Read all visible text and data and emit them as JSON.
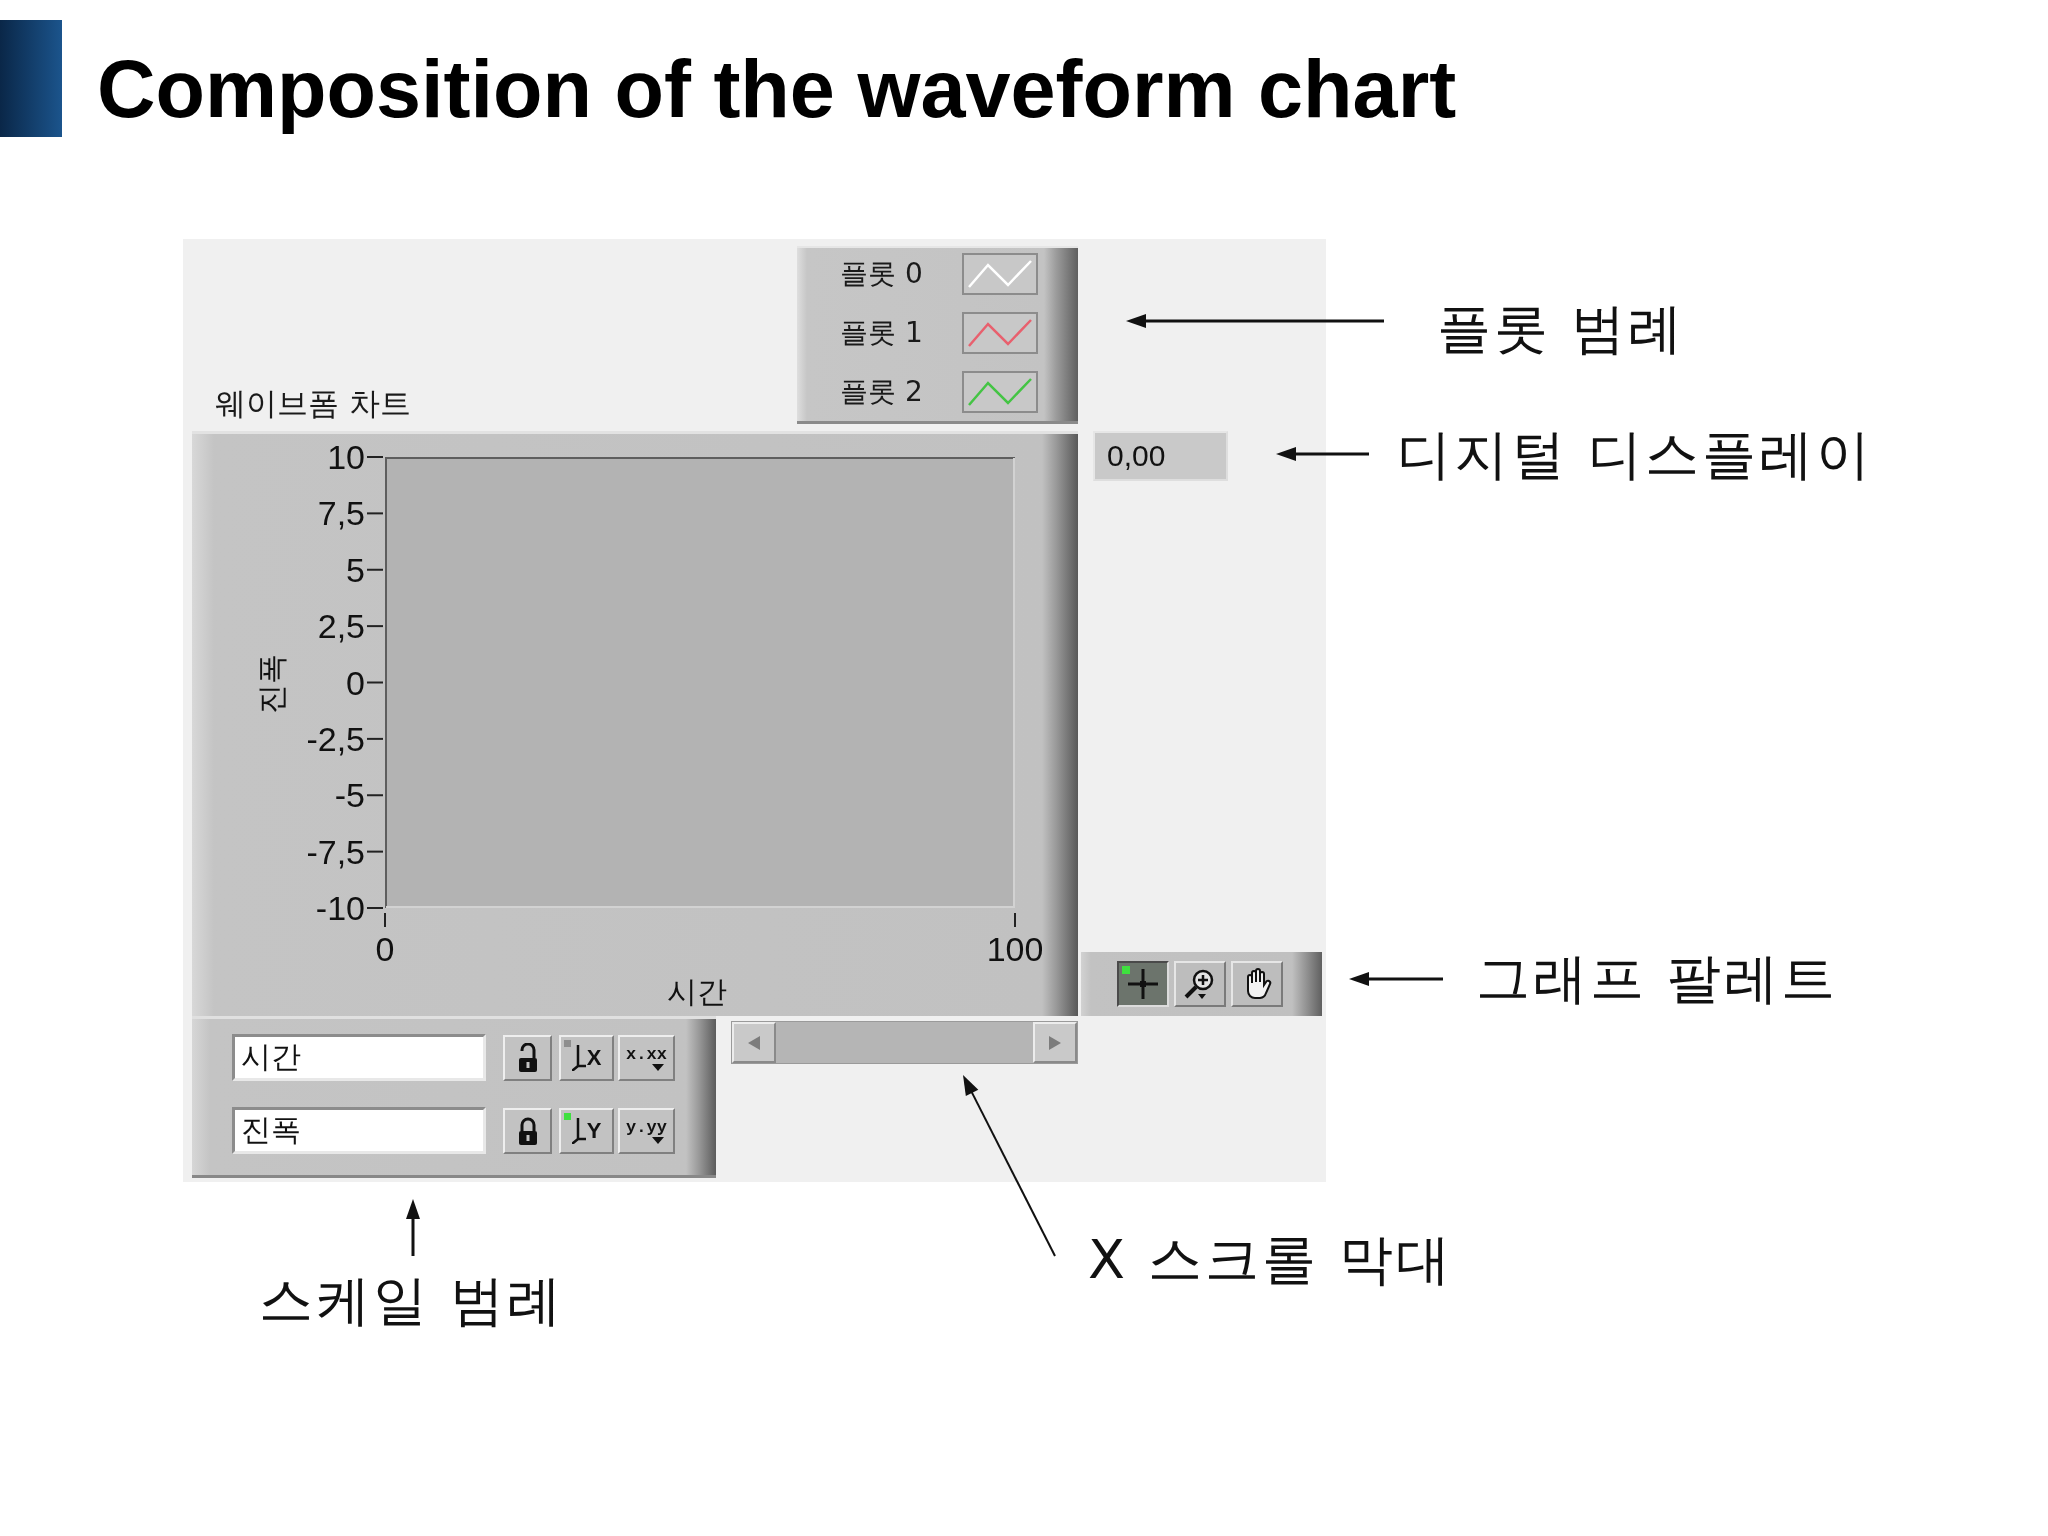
{
  "slide": {
    "title": "Composition of the waveform chart"
  },
  "waveform_chart": {
    "label": "웨이브폼 차트",
    "plot_legend": [
      {
        "name": "플롯 0",
        "color": "#ffffff"
      },
      {
        "name": "플롯 1",
        "color": "#e8606e"
      },
      {
        "name": "플롯 2",
        "color": "#44c444"
      }
    ],
    "chart_data": {
      "type": "line",
      "xlabel": "시간",
      "ylabel": "진폭",
      "xlim": [
        0,
        100
      ],
      "ylim": [
        -10,
        10
      ],
      "xticks": [
        0,
        100
      ],
      "yticks": [
        {
          "value": 10,
          "label": "10"
        },
        {
          "value": 7.5,
          "label": "7,5"
        },
        {
          "value": 5,
          "label": "5"
        },
        {
          "value": 2.5,
          "label": "2,5"
        },
        {
          "value": 0,
          "label": "0"
        },
        {
          "value": -2.5,
          "label": "-2,5"
        },
        {
          "value": -5,
          "label": "-5"
        },
        {
          "value": -7.5,
          "label": "-7,5"
        },
        {
          "value": -10,
          "label": "-10"
        }
      ]
    },
    "digital_display": "0,00",
    "graph_palette": [
      {
        "kind": "cursor",
        "selected": true
      },
      {
        "kind": "zoom",
        "selected": false
      },
      {
        "kind": "pan",
        "selected": false
      }
    ],
    "scale_legend": [
      {
        "name": "시간",
        "locked": false,
        "autoscale_button": "X",
        "autoscale": false,
        "format_button": "x.xx"
      },
      {
        "name": "진폭",
        "locked": true,
        "autoscale_button": "Y",
        "autoscale": true,
        "format_button": "y.yy"
      }
    ]
  },
  "annotations": [
    "플롯 범례",
    "디지털 디스플레이",
    "그래프 팔레트",
    "X 스크롤 막대",
    "스케일 범례"
  ]
}
